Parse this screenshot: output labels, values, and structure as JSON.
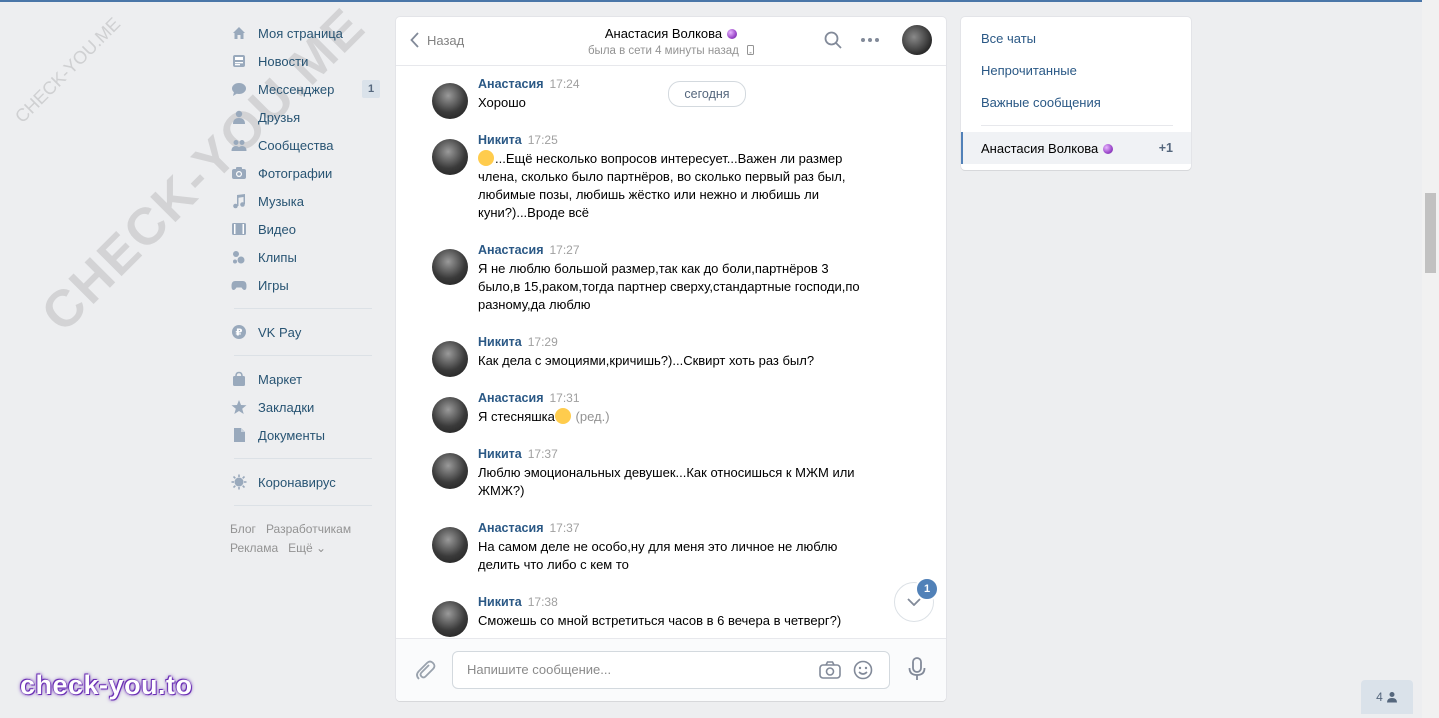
{
  "nav": {
    "items": [
      {
        "label": "Моя страница",
        "icon": "home-icon"
      },
      {
        "label": "Новости",
        "icon": "news-icon"
      },
      {
        "label": "Мессенджер",
        "icon": "messenger-icon",
        "count": "1"
      },
      {
        "label": "Друзья",
        "icon": "friends-icon"
      },
      {
        "label": "Сообщества",
        "icon": "communities-icon"
      },
      {
        "label": "Фотографии",
        "icon": "camera-icon"
      },
      {
        "label": "Музыка",
        "icon": "music-icon"
      },
      {
        "label": "Видео",
        "icon": "video-icon"
      },
      {
        "label": "Клипы",
        "icon": "clips-icon"
      },
      {
        "label": "Игры",
        "icon": "gamepad-icon"
      }
    ],
    "pay": {
      "label": "VK Pay",
      "icon": "vkpay-icon"
    },
    "items2": [
      {
        "label": "Маркет",
        "icon": "bag-icon"
      },
      {
        "label": "Закладки",
        "icon": "star-icon"
      },
      {
        "label": "Документы",
        "icon": "document-icon"
      }
    ],
    "corona": {
      "label": "Коронавирус",
      "icon": "virus-icon"
    },
    "footer": [
      "Блог",
      "Разработчикам",
      "Реклама",
      "Ещё ⌄"
    ]
  },
  "chat": {
    "back_label": "Назад",
    "peer_name": "Анастасия Волкова",
    "peer_status": "была в сети 4 минуты назад",
    "today_label": "сегодня",
    "unread_badge": "1",
    "messages": [
      {
        "author": "Анастасия",
        "time": "17:24",
        "text": "Хорошо"
      },
      {
        "author": "Никита",
        "time": "17:25",
        "text": "...Ещё несколько вопросов интересует...Важен ли размер члена, сколько было партнёров, во сколько первый раз был, любимые позы, любишь жёстко или нежно и любишь ли куни?)...Вроде всё"
      },
      {
        "author": "Анастасия",
        "time": "17:27",
        "text": "Я не люблю большой размер,так как до боли,партнёров 3 было,в 15,раком,тогда партнер сверху,стандартные господи,по разному,да люблю"
      },
      {
        "author": "Никита",
        "time": "17:29",
        "text": "Как дела с эмоциями,кричишь?)...Сквирт хоть раз был?"
      },
      {
        "author": "Анастасия",
        "time": "17:31",
        "text": "Я стесняшка",
        "edited": "(ред.)"
      },
      {
        "author": "Никита",
        "time": "17:37",
        "text": "Люблю эмоциональных девушек...Как относишься к МЖМ или ЖМЖ?)"
      },
      {
        "author": "Анастасия",
        "time": "17:37",
        "text": "На самом деле не особо,ну для меня это личное не люблю делить что либо с кем то"
      },
      {
        "author": "Никита",
        "time": "17:38",
        "text": "Сможешь со мной встретиться часов в 6 вечера в четверг?)"
      }
    ],
    "composer_placeholder": "Напишите сообщение..."
  },
  "right_panel": {
    "all_chats": "Все чаты",
    "unread": "Непрочитанные",
    "important": "Важные сообщения",
    "active_chat": {
      "name": "Анастасия Волкова",
      "count": "+1"
    }
  },
  "watermarks": {
    "big": "CHECK-YOU.ME",
    "small": "CHECK-YOU.ME",
    "logo": "check-you.to"
  },
  "mini_chat": {
    "count": "4"
  },
  "colors": {
    "accent": "#5181b8",
    "link": "#2a5885",
    "bg": "#edeef0"
  }
}
